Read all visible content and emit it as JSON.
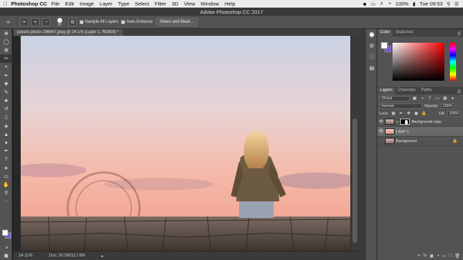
{
  "menubar": {
    "apple": "",
    "app": "Photoshop CC",
    "items": [
      "File",
      "Edit",
      "Image",
      "Layer",
      "Type",
      "Select",
      "Filter",
      "3D",
      "View",
      "Window",
      "Help"
    ],
    "battery": "100%",
    "clock": "Tue 09:53"
  },
  "window": {
    "title": "Adobe Photoshop CC 2017"
  },
  "options": {
    "brush_size": "20",
    "sample_all_layers": "Sample All Layers",
    "auto_enhance": "Auto-Enhance",
    "select_mask": "Select and Mask..."
  },
  "document": {
    "tab": "pexels-photo-196667.jpeg @ 24.1% (Layer 1, RGB/8) *",
    "zoom": "24.11%",
    "doc_info": "Doc: 30.5M/117.8M"
  },
  "panels": {
    "color_tabs": [
      "Color",
      "Swatches"
    ],
    "layers_tabs": [
      "Layers",
      "Channels",
      "Paths"
    ],
    "kind": "Kind",
    "blend_mode": "Normal",
    "opacity_label": "Opacity:",
    "opacity": "100%",
    "lock_label": "Lock:",
    "fill_label": "Fill:",
    "fill": "100%",
    "layers": [
      {
        "name": "Background copy",
        "mask": true,
        "selected": false,
        "locked": false
      },
      {
        "name": "Layer 1",
        "mask": false,
        "selected": true,
        "locked": false
      },
      {
        "name": "Background",
        "mask": false,
        "selected": false,
        "locked": true
      }
    ]
  },
  "colors": {
    "foreground": "#ffffff",
    "background": "#7b55d8",
    "sky_top": "#cfd6e6",
    "sky_bottom": "#f2a99a",
    "stone": "#5d5149"
  }
}
